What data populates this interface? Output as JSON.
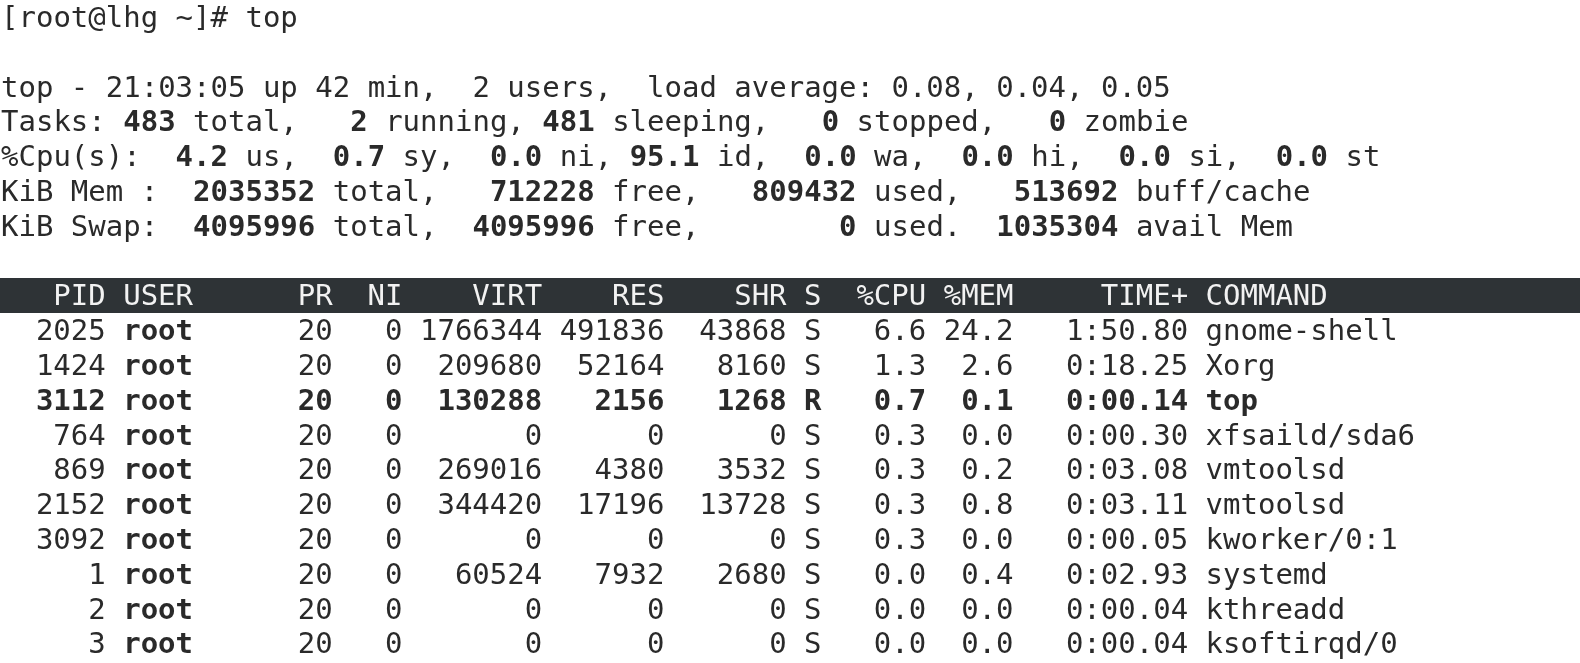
{
  "prompt": "[root@lhg ~]# top",
  "summary": [
    "top - 21:03:05 up 42 min,  2 users,  load average: 0.08, 0.04, 0.05",
    "Tasks: **483** total,   **2** running, **481** sleeping,   **0** stopped,   **0** zombie",
    "%Cpu(s):  **4.2** us,  **0.7** sy,  **0.0** ni, **95.1** id,  **0.0** wa,  **0.0** hi,  **0.0** si,  **0.0** st",
    "KiB Mem :  **2035352** total,   **712228** free,   **809432** used,   **513692** buff/cache",
    "KiB Swap:  **4095996** total,  **4095996** free,        **0** used.  **1035304** avail Mem"
  ],
  "table": {
    "columns": [
      {
        "label": "PID",
        "kind": "number"
      },
      {
        "label": "USER",
        "kind": "text"
      },
      {
        "label": "PR",
        "kind": "number"
      },
      {
        "label": "NI",
        "kind": "number"
      },
      {
        "label": "VIRT",
        "kind": "number"
      },
      {
        "label": "RES",
        "kind": "number"
      },
      {
        "label": "SHR",
        "kind": "number"
      },
      {
        "label": "S",
        "kind": "text"
      },
      {
        "label": "%CPU",
        "kind": "number"
      },
      {
        "label": "%MEM",
        "kind": "number"
      },
      {
        "label": "TIME+",
        "kind": "number"
      },
      {
        "label": "COMMAND",
        "kind": "text"
      }
    ],
    "rows": [
      {
        "highlighted": false,
        "cells": [
          "2025",
          "root",
          "20",
          "0",
          "1766344",
          "491836",
          "43868",
          "S",
          "6.6",
          "24.2",
          "1:50.80",
          "gnome-shell"
        ]
      },
      {
        "highlighted": false,
        "cells": [
          "1424",
          "root",
          "20",
          "0",
          "209680",
          "52164",
          "8160",
          "S",
          "1.3",
          "2.6",
          "0:18.25",
          "Xorg"
        ]
      },
      {
        "highlighted": true,
        "cells": [
          "3112",
          "root",
          "20",
          "0",
          "130288",
          "2156",
          "1268",
          "R",
          "0.7",
          "0.1",
          "0:00.14",
          "top"
        ]
      },
      {
        "highlighted": false,
        "cells": [
          "764",
          "root",
          "20",
          "0",
          "0",
          "0",
          "0",
          "S",
          "0.3",
          "0.0",
          "0:00.30",
          "xfsaild/sda6"
        ]
      },
      {
        "highlighted": false,
        "cells": [
          "869",
          "root",
          "20",
          "0",
          "269016",
          "4380",
          "3532",
          "S",
          "0.3",
          "0.2",
          "0:03.08",
          "vmtoolsd"
        ]
      },
      {
        "highlighted": false,
        "cells": [
          "2152",
          "root",
          "20",
          "0",
          "344420",
          "17196",
          "13728",
          "S",
          "0.3",
          "0.8",
          "0:03.11",
          "vmtoolsd"
        ]
      },
      {
        "highlighted": false,
        "cells": [
          "3092",
          "root",
          "20",
          "0",
          "0",
          "0",
          "0",
          "S",
          "0.3",
          "0.0",
          "0:00.05",
          "kworker/0:1"
        ]
      },
      {
        "highlighted": false,
        "cells": [
          "1",
          "root",
          "20",
          "0",
          "60524",
          "7932",
          "2680",
          "S",
          "0.0",
          "0.4",
          "0:02.93",
          "systemd"
        ]
      },
      {
        "highlighted": false,
        "cells": [
          "2",
          "root",
          "20",
          "0",
          "0",
          "0",
          "0",
          "S",
          "0.0",
          "0.0",
          "0:00.04",
          "kthreadd"
        ]
      },
      {
        "highlighted": false,
        "cells": [
          "3",
          "root",
          "20",
          "0",
          "0",
          "0",
          "0",
          "S",
          "0.0",
          "0.0",
          "0:00.04",
          "ksoftirqd/0"
        ]
      }
    ]
  }
}
